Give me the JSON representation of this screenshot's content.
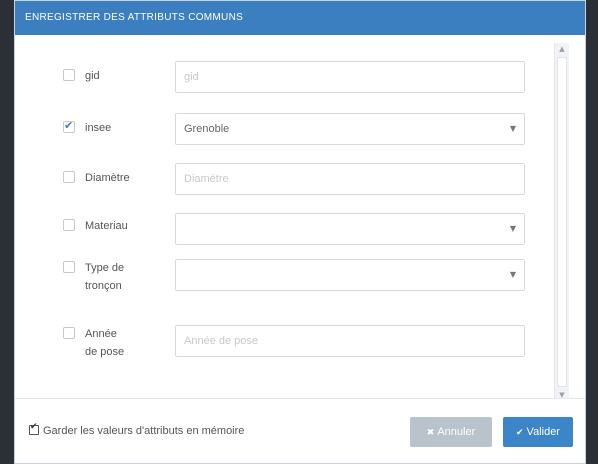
{
  "dialog": {
    "title": "Enregistrer des attributs communs"
  },
  "fields": [
    {
      "label": "gid",
      "checked": false,
      "type": "text",
      "value": "",
      "placeholder": "gid"
    },
    {
      "label": "insee",
      "checked": true,
      "type": "select",
      "value": "Grenoble",
      "placeholder": ""
    },
    {
      "label": "Diamètre",
      "checked": false,
      "type": "text",
      "value": "",
      "placeholder": "Diamètre"
    },
    {
      "label": "Materiau",
      "checked": false,
      "type": "select",
      "value": "",
      "placeholder": ""
    },
    {
      "label": "Type de tronçon",
      "checked": false,
      "type": "select",
      "value": "",
      "placeholder": ""
    },
    {
      "label": "Année de pose",
      "checked": false,
      "type": "text",
      "value": "",
      "placeholder": "Année de pose"
    }
  ],
  "labels": {
    "gid": "gid",
    "insee": "insee",
    "diametre": "Diamètre",
    "materiau": "Materiau",
    "type_troncon": "Type de tronçon",
    "annee_pose": "Année de pose"
  },
  "values": {
    "insee": "Grenoble"
  },
  "placeholders": {
    "gid": "gid",
    "diametre": "Diamètre",
    "annee_pose": "Année de pose"
  },
  "footer": {
    "remember_label": "Garder les valeurs d'attributs en mémoire",
    "remember_checked": true,
    "cancel_label": "Annuler",
    "ok_label": "Valider"
  },
  "icons": {
    "cancel": "close-icon",
    "ok": "check-icon",
    "select_caret": "caret-down-icon"
  },
  "colors": {
    "titlebar": "#3c7fc1",
    "ok_button": "#3c85c8",
    "cancel_button": "#b9c3cc"
  }
}
